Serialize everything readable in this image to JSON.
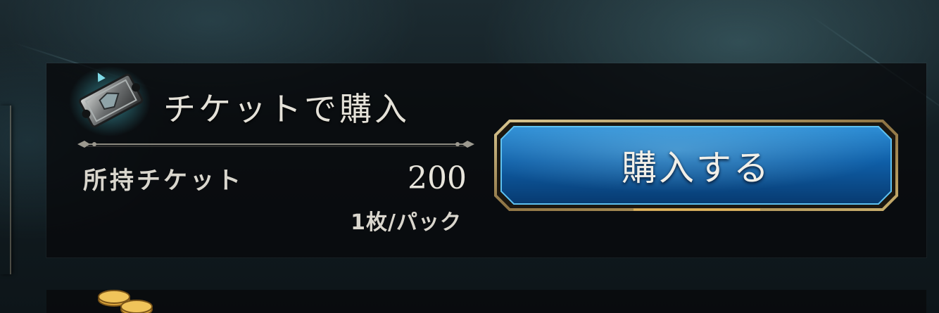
{
  "ticket_purchase": {
    "title": "チケットで購入",
    "owned_label": "所持チケット",
    "owned_count": "200",
    "cost_per_pack": "1枚/パック",
    "buy_button_label": "購入する"
  },
  "icons": {
    "ticket": "ticket-icon",
    "coins": "gold-coin-stack-icon"
  },
  "colors": {
    "button_blue": "#0f5fa8",
    "button_border_gold": "#b89a5a",
    "panel_bg": "#080a0c",
    "text_light": "#e4e1d8"
  }
}
